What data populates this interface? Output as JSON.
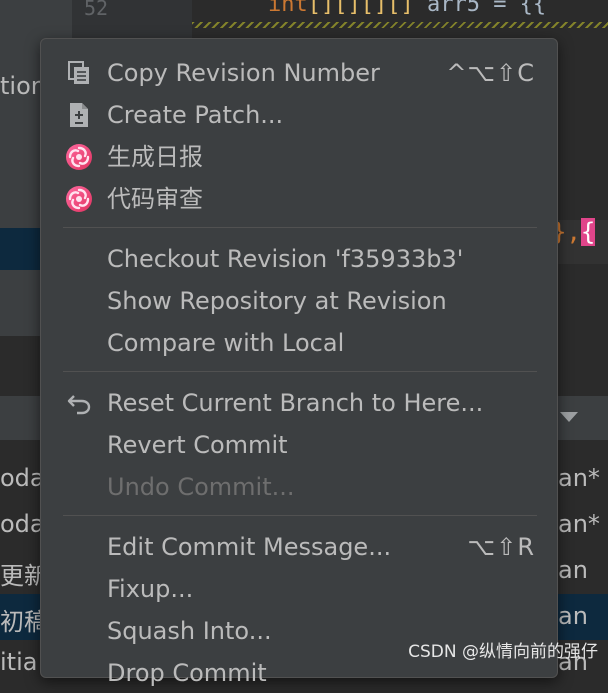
{
  "background": {
    "line_number": "52",
    "code_line": {
      "keyword": "int",
      "brackets": "[][][][]",
      "rest": " arr5 = {{"
    },
    "left_stub": "tion",
    "tokens": {
      "a": "},",
      "b": "{"
    },
    "bottom_rows": [
      {
        "left": "oda",
        "right": "an*"
      },
      {
        "left": "oda",
        "right": "an*"
      },
      {
        "left": "更新",
        "right": "an"
      },
      {
        "left": "初稿",
        "right": "an"
      },
      {
        "left": "itia",
        "right": "an"
      }
    ]
  },
  "menu": {
    "groups": [
      [
        {
          "label": "Copy Revision Number",
          "shortcut": "^⌥⇧C",
          "icon": "copy-icon"
        },
        {
          "label": "Create Patch...",
          "shortcut": "",
          "icon": "patch-icon"
        },
        {
          "label": "生成日报",
          "shortcut": "",
          "icon": "ai-plugin-icon"
        },
        {
          "label": "代码审查",
          "shortcut": "",
          "icon": "ai-plugin-icon"
        }
      ],
      [
        {
          "label": "Checkout Revision 'f35933b3'",
          "shortcut": ""
        },
        {
          "label": "Show Repository at Revision",
          "shortcut": ""
        },
        {
          "label": "Compare with Local",
          "shortcut": ""
        }
      ],
      [
        {
          "label": "Reset Current Branch to Here...",
          "shortcut": "",
          "icon": "undo-arrow-icon"
        },
        {
          "label": "Revert Commit",
          "shortcut": ""
        },
        {
          "label": "Undo Commit...",
          "shortcut": "",
          "disabled": true
        }
      ],
      [
        {
          "label": "Edit Commit Message...",
          "shortcut": "⌥⇧R"
        },
        {
          "label": "Fixup...",
          "shortcut": ""
        },
        {
          "label": "Squash Into...",
          "shortcut": ""
        },
        {
          "label": "Drop Commit",
          "shortcut": ""
        }
      ]
    ]
  },
  "watermark": "CSDN @纵情向前的强仔",
  "colors": {
    "menu_bg": "#3c3f41",
    "accent_pink": "#e0458a",
    "selection": "#0d293e"
  }
}
